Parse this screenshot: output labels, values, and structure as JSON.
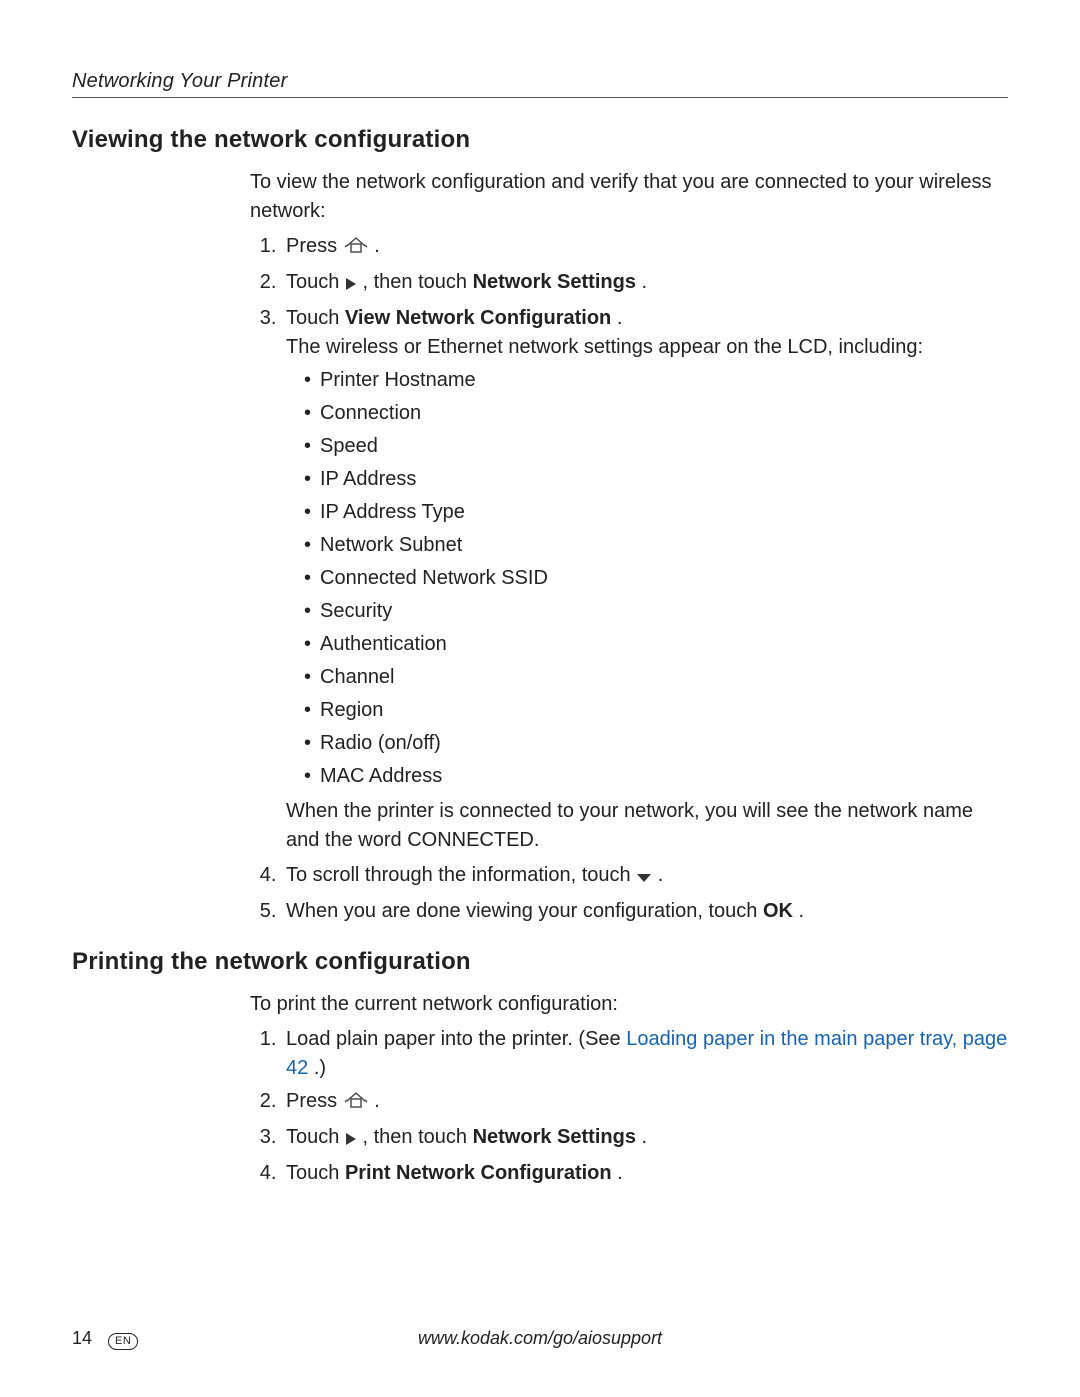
{
  "runningHead": "Networking Your Printer",
  "sec1": {
    "title": "Viewing the network configuration",
    "intro": "To view the network configuration and verify that you are connected to your wireless network:",
    "step1a": "Press ",
    "step1b": ".",
    "step2a": "Touch ",
    "step2b": " , then touch ",
    "step2bold": "Network Settings",
    "step2c": ".",
    "step3a": "Touch ",
    "step3bold": "View Network Configuration",
    "step3b": ".",
    "step3desc": "The wireless or Ethernet network settings appear on the LCD, including:",
    "bullets": [
      "Printer Hostname",
      "Connection",
      "Speed",
      "IP Address",
      "IP Address Type",
      "Network Subnet",
      "Connected Network SSID",
      "Security",
      "Authentication",
      "Channel",
      "Region",
      "Radio (on/off)",
      "MAC Address"
    ],
    "afterBullets": "When the printer is connected to your network, you will see the network name and the word CONNECTED.",
    "step4a": "To scroll through the information, touch ",
    "step4b": ".",
    "step5a": "When you are done viewing your configuration, touch ",
    "step5bold": "OK",
    "step5b": "."
  },
  "sec2": {
    "title": "Printing the network configuration",
    "intro": "To print the current network configuration:",
    "step1a": "Load plain paper into the printer. (See ",
    "step1link": "Loading paper in the main paper tray, page 42",
    "step1b": ".)",
    "step2a": "Press ",
    "step2b": ".",
    "step3a": "Touch ",
    "step3b": " , then touch ",
    "step3bold": "Network Settings",
    "step3c": ".",
    "step4a": "Touch ",
    "step4bold": "Print Network Configuration",
    "step4b": "."
  },
  "footer": {
    "pageNum": "14",
    "lang": "EN",
    "url": "www.kodak.com/go/aiosupport"
  }
}
